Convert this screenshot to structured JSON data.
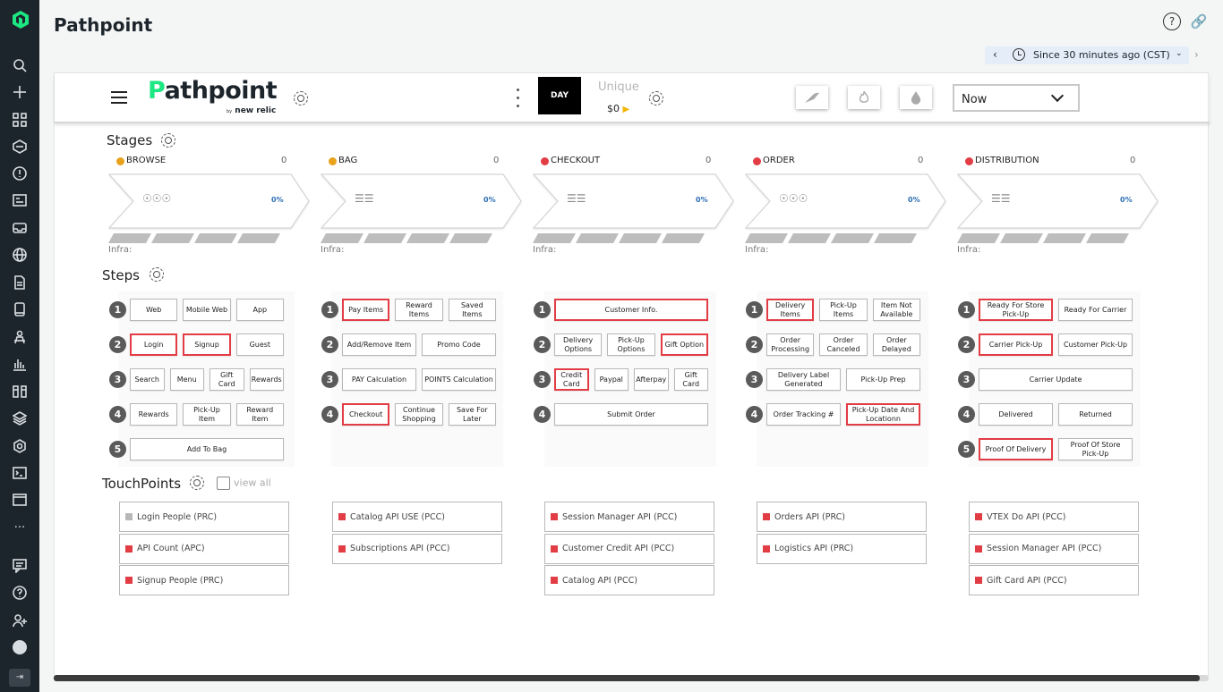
{
  "page_title": "Pathpoint",
  "time_picker": {
    "label": "Since 30 minutes ago (CST)"
  },
  "header": {
    "logo_text": "athpoint",
    "logo_initial": "P",
    "by_label": "by",
    "brand_label": "new relic",
    "day_label": "DAY",
    "unique_label": "Unique",
    "amount": "$0",
    "timeframe_select": "Now"
  },
  "sections": {
    "stages": "Stages",
    "steps": "Steps",
    "touchpoints": "TouchPoints",
    "view_all": "view all"
  },
  "colors": {
    "red": "#e23d45",
    "yellow": "#e8a21c",
    "green": "#1ce783"
  },
  "stages": [
    {
      "name": "BROWSE",
      "count": "0",
      "status": "yellow",
      "icon": "people-icon",
      "pct": "0%",
      "infra": "Infra:"
    },
    {
      "name": "BAG",
      "count": "0",
      "status": "yellow",
      "icon": "bars-icon",
      "pct": "0%",
      "infra": "Infra:"
    },
    {
      "name": "CHECKOUT",
      "count": "0",
      "status": "red",
      "icon": "bars-icon",
      "pct": "0%",
      "infra": "Infra:"
    },
    {
      "name": "ORDER",
      "count": "0",
      "status": "red",
      "icon": "people-icon",
      "pct": "0%",
      "infra": "Infra:"
    },
    {
      "name": "DISTRIBUTION",
      "count": "0",
      "status": "red",
      "icon": "bars-icon",
      "pct": "0%",
      "infra": "Infra:"
    }
  ],
  "steps": [
    {
      "rows": [
        {
          "n": "1",
          "items": [
            {
              "label": "Web",
              "alert": false
            },
            {
              "label": "Mobile Web",
              "alert": false
            },
            {
              "label": "App",
              "alert": false
            }
          ]
        },
        {
          "n": "2",
          "items": [
            {
              "label": "Login",
              "alert": true
            },
            {
              "label": "Signup",
              "alert": true
            },
            {
              "label": "Guest",
              "alert": false
            }
          ]
        },
        {
          "n": "3",
          "items": [
            {
              "label": "Search",
              "alert": false
            },
            {
              "label": "Menu",
              "alert": false
            },
            {
              "label": "Gift Card",
              "alert": false
            },
            {
              "label": "Rewards",
              "alert": false
            }
          ]
        },
        {
          "n": "4",
          "items": [
            {
              "label": "Rewards",
              "alert": false
            },
            {
              "label": "Pick-Up Item",
              "alert": false
            },
            {
              "label": "Reward Item",
              "alert": false
            }
          ]
        },
        {
          "n": "5",
          "items": [
            {
              "label": "Add To Bag",
              "alert": false
            }
          ]
        }
      ]
    },
    {
      "rows": [
        {
          "n": "1",
          "items": [
            {
              "label": "Pay Items",
              "alert": true
            },
            {
              "label": "Reward Items",
              "alert": false
            },
            {
              "label": "Saved Items",
              "alert": false
            }
          ]
        },
        {
          "n": "2",
          "items": [
            {
              "label": "Add/Remove Item",
              "alert": false
            },
            {
              "label": "Promo Code",
              "alert": false
            }
          ]
        },
        {
          "n": "3",
          "items": [
            {
              "label": "PAY Calculation",
              "alert": false
            },
            {
              "label": "POINTS Calculation",
              "alert": false
            }
          ]
        },
        {
          "n": "4",
          "items": [
            {
              "label": "Checkout",
              "alert": true
            },
            {
              "label": "Continue Shopping",
              "alert": false
            },
            {
              "label": "Save For Later",
              "alert": false
            }
          ]
        }
      ]
    },
    {
      "rows": [
        {
          "n": "1",
          "items": [
            {
              "label": "Customer Info.",
              "alert": true
            }
          ]
        },
        {
          "n": "2",
          "items": [
            {
              "label": "Delivery Options",
              "alert": false
            },
            {
              "label": "Pick-Up Options",
              "alert": false
            },
            {
              "label": "Gift Option",
              "alert": true
            }
          ]
        },
        {
          "n": "3",
          "items": [
            {
              "label": "Credit Card",
              "alert": true
            },
            {
              "label": "Paypal",
              "alert": false
            },
            {
              "label": "Afterpay",
              "alert": false
            },
            {
              "label": "Gift Card",
              "alert": false
            }
          ]
        },
        {
          "n": "4",
          "items": [
            {
              "label": "Submit Order",
              "alert": false
            }
          ]
        }
      ]
    },
    {
      "rows": [
        {
          "n": "1",
          "items": [
            {
              "label": "Delivery Items",
              "alert": true
            },
            {
              "label": "Pick-Up Items",
              "alert": false
            },
            {
              "label": "Item Not Available",
              "alert": false
            }
          ]
        },
        {
          "n": "2",
          "items": [
            {
              "label": "Order Processing",
              "alert": false
            },
            {
              "label": "Order Canceled",
              "alert": false
            },
            {
              "label": "Order Delayed",
              "alert": false
            }
          ]
        },
        {
          "n": "3",
          "items": [
            {
              "label": "Delivery Label Generated",
              "alert": false
            },
            {
              "label": "Pick-Up Prep",
              "alert": false
            }
          ]
        },
        {
          "n": "4",
          "items": [
            {
              "label": "Order Tracking #",
              "alert": false
            },
            {
              "label": "Pick-Up Date And Locationn",
              "alert": true
            }
          ]
        }
      ]
    },
    {
      "rows": [
        {
          "n": "1",
          "items": [
            {
              "label": "Ready For Store Pick-Up",
              "alert": true
            },
            {
              "label": "Ready For Carrier",
              "alert": false
            }
          ]
        },
        {
          "n": "2",
          "items": [
            {
              "label": "Carrier Pick-Up",
              "alert": true
            },
            {
              "label": "Customer Pick-Up",
              "alert": false
            }
          ]
        },
        {
          "n": "3",
          "items": [
            {
              "label": "Carrier Update",
              "alert": false
            }
          ]
        },
        {
          "n": "4",
          "items": [
            {
              "label": "Delivered",
              "alert": false
            },
            {
              "label": "Returned",
              "alert": false
            }
          ]
        },
        {
          "n": "5",
          "items": [
            {
              "label": "Proof Of Delivery",
              "alert": true
            },
            {
              "label": "Proof Of Store Pick-Up",
              "alert": false
            }
          ]
        }
      ]
    }
  ],
  "touchpoints": [
    [
      {
        "label": "Login People (PRC)",
        "status": "grey"
      },
      {
        "label": "API Count (APC)",
        "status": "red"
      },
      {
        "label": "Signup People (PRC)",
        "status": "red"
      }
    ],
    [
      {
        "label": "Catalog API USE (PCC)",
        "status": "red"
      },
      {
        "label": "Subscriptions API (PCC)",
        "status": "red"
      }
    ],
    [
      {
        "label": "Session Manager API (PCC)",
        "status": "red"
      },
      {
        "label": "Customer Credit API (PCC)",
        "status": "red"
      },
      {
        "label": "Catalog API (PCC)",
        "status": "red"
      }
    ],
    [
      {
        "label": "Orders API (PRC)",
        "status": "red"
      },
      {
        "label": "Logistics API (PRC)",
        "status": "red"
      }
    ],
    [
      {
        "label": "VTEX Do API (PCC)",
        "status": "red"
      },
      {
        "label": "Session Manager API (PCC)",
        "status": "red"
      },
      {
        "label": "Gift Card API (PCC)",
        "status": "red"
      }
    ]
  ],
  "nav_rail": [
    "new-relic-logo-icon",
    "search-icon",
    "add-icon",
    "apps-grid-icon",
    "apm-icon",
    "alerts-icon",
    "dashboards-icon",
    "inbox-icon",
    "browser-globe-icon",
    "logs-icon",
    "mobile-icon",
    "synthetics-icon",
    "chart-icon",
    "infrastructure-icon",
    "layers-icon",
    "settings-icon",
    "terminal-icon",
    "window-icon",
    "more-icon",
    "feedback-icon",
    "help-icon",
    "add-user-icon",
    "avatar",
    "collapse-icon"
  ]
}
